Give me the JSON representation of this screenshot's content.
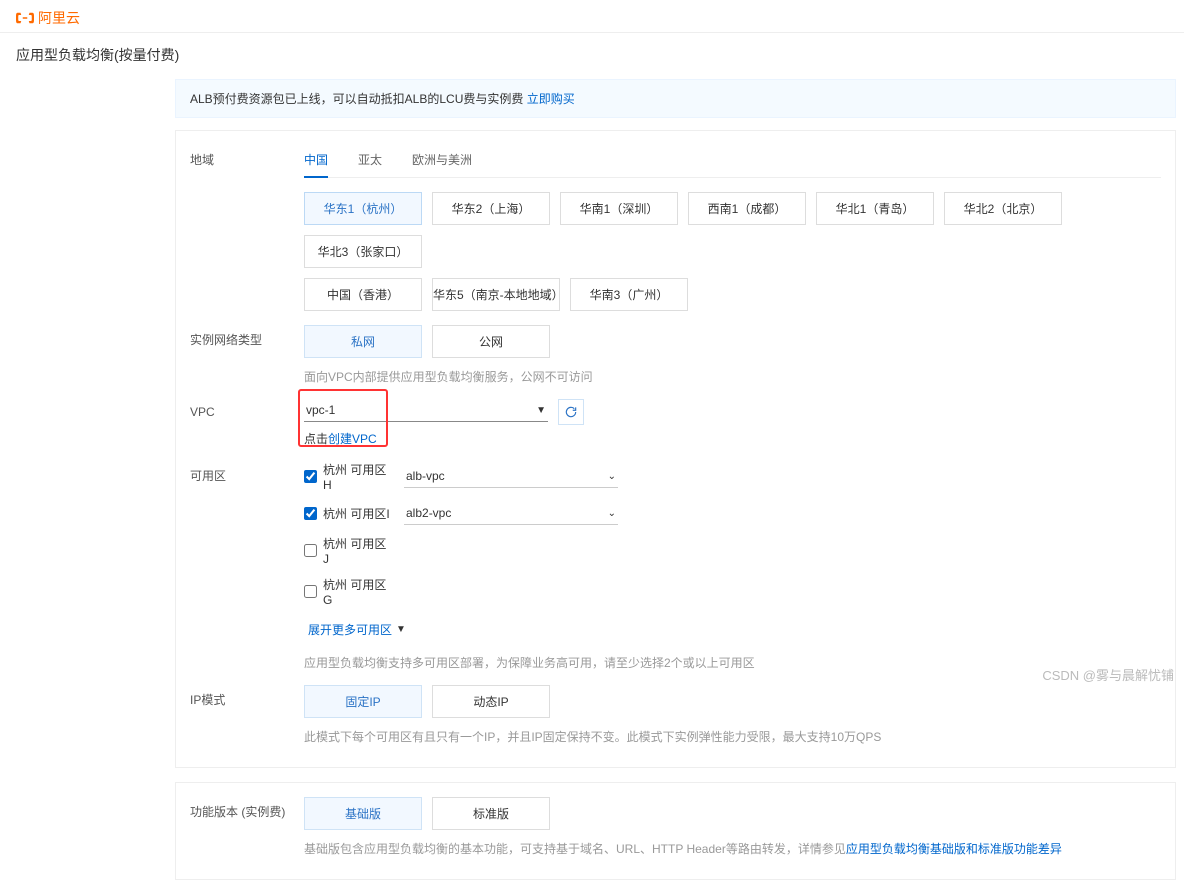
{
  "header": {
    "brand": "阿里云"
  },
  "page": {
    "title": "应用型负载均衡(按量付费)"
  },
  "notice": {
    "text": "ALB预付费资源包已上线，可以自动抵扣ALB的LCU费与实例费 ",
    "link": "立即购买"
  },
  "region": {
    "label": "地域",
    "tabs": [
      "中国",
      "亚太",
      "欧洲与美洲"
    ],
    "row1": [
      "华东1（杭州）",
      "华东2（上海）",
      "华南1（深圳）",
      "西南1（成都）",
      "华北1（青岛）",
      "华北2（北京）",
      "华北3（张家口）"
    ],
    "row2": [
      "中国（香港）",
      "华东5（南京-本地地域）",
      "华南3（广州）"
    ]
  },
  "network": {
    "label": "实例网络类型",
    "options": [
      "私网",
      "公网"
    ],
    "hint": "面向VPC内部提供应用型负载均衡服务，公网不可访问"
  },
  "vpc": {
    "label": "VPC",
    "value": "vpc-1",
    "create_prefix": "点击",
    "create_link": "创建VPC"
  },
  "zones": {
    "label": "可用区",
    "items": [
      {
        "name": "杭州 可用区H",
        "checked": true,
        "vswitch": "alb-vpc"
      },
      {
        "name": "杭州 可用区I",
        "checked": true,
        "vswitch": "alb2-vpc"
      },
      {
        "name": "杭州 可用区J",
        "checked": false,
        "vswitch": ""
      },
      {
        "name": "杭州 可用区G",
        "checked": false,
        "vswitch": ""
      }
    ],
    "expand": "展开更多可用区",
    "hint": "应用型负载均衡支持多可用区部署，为保障业务高可用，请至少选择2个或以上可用区"
  },
  "ipmode": {
    "label": "IP模式",
    "options": [
      "固定IP",
      "动态IP"
    ],
    "hint": "此模式下每个可用区有且只有一个IP，并且IP固定保持不变。此模式下实例弹性能力受限，最大支持10万QPS"
  },
  "edition": {
    "label": "功能版本 (实例费)",
    "options": [
      "基础版",
      "标准版"
    ],
    "hint_prefix": "基础版包含应用型负载均衡的基本功能，可支持基于域名、URL、HTTP Header等路由转发，详情参见",
    "hint_link": "应用型负载均衡基础版和标准版功能差异"
  },
  "watermark": "CSDN @雾与晨解忧铺"
}
